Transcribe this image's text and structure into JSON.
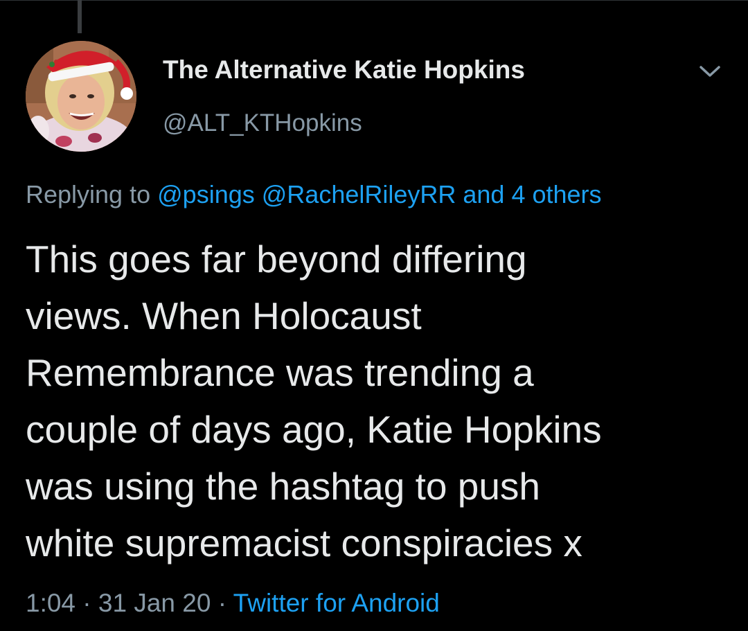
{
  "author": {
    "name": "The Alternative Katie Hopkins",
    "handle": "@ALT_KTHopkins"
  },
  "reply_context": {
    "prefix": "Replying to",
    "mentions": [
      "@psings",
      "@RachelRileyRR"
    ],
    "others": "and 4 others"
  },
  "tweet": {
    "lines": [
      "This goes far beyond differing",
      "views. When Holocaust",
      "Remembrance was trending a",
      "couple of days ago, Katie Hopkins",
      "was using the hashtag to push",
      "white supremacist conspiracies x"
    ]
  },
  "meta": {
    "time": "1:04",
    "separator": "·",
    "date": "31 Jan 20",
    "source": "Twitter for Android"
  },
  "icons": {
    "menu": "chevron-down-icon",
    "avatar": "profile-photo-santa-hat"
  },
  "colors": {
    "background": "#000000",
    "primary_text": "#e7e9ea",
    "secondary_text": "#8899a6",
    "link": "#1da1f2"
  }
}
